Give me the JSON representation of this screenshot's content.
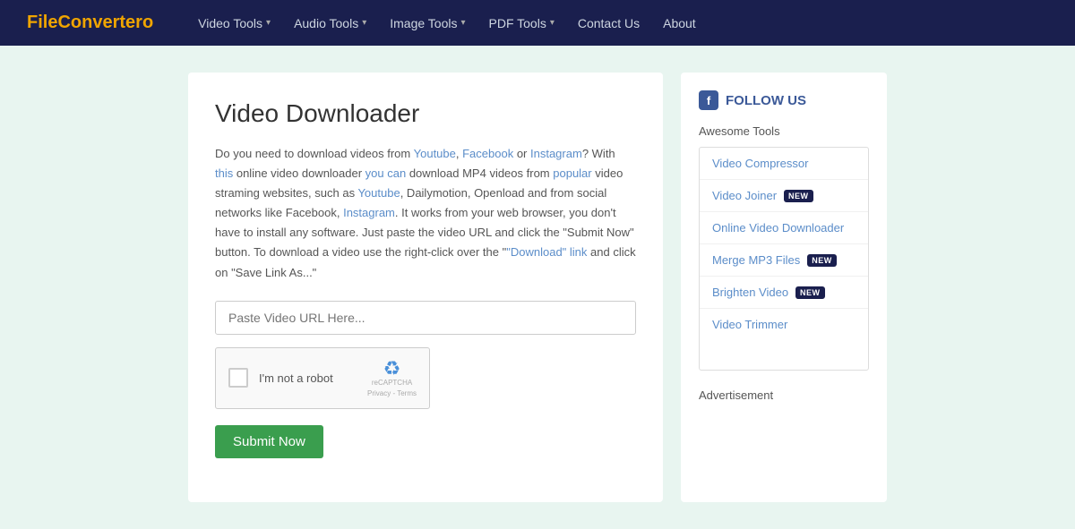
{
  "brand": {
    "name_start": "FileConverter",
    "name_highlight": "o"
  },
  "nav": {
    "links": [
      {
        "label": "Video Tools",
        "has_dropdown": true
      },
      {
        "label": "Audio Tools",
        "has_dropdown": true
      },
      {
        "label": "Image Tools",
        "has_dropdown": true
      },
      {
        "label": "PDF Tools",
        "has_dropdown": true
      },
      {
        "label": "Contact Us",
        "has_dropdown": false
      },
      {
        "label": "About",
        "has_dropdown": false
      }
    ]
  },
  "main": {
    "title": "Video Downloader",
    "description": "Do you need to download videos from Youtube, Facebook or Instagram? With this online video downloader you can download MP4 videos from popular video straming websites, such as Youtube, Dailymotion, Openload and from social networks like Facebook, Instagram. It works from your web browser, you don't have to install any software. Just paste the video URL and click the \"Submit Now\" button. To download a video use the right-click over the \"Download\" link and click on \"Save Link As...\"",
    "url_input_placeholder": "Paste Video URL Here...",
    "submit_label": "Submit Now",
    "recaptcha_label": "I'm not a robot",
    "recaptcha_brand": "reCAPTCHA",
    "recaptcha_privacy": "Privacy - Terms"
  },
  "sidebar": {
    "follow_label": "FOLLOW US",
    "awesome_tools_label": "Awesome Tools",
    "tools": [
      {
        "label": "Video Compressor",
        "is_new": false
      },
      {
        "label": "Video Joiner",
        "is_new": true
      },
      {
        "label": "Online Video Downloader",
        "is_new": false
      },
      {
        "label": "Merge MP3 Files",
        "is_new": true
      },
      {
        "label": "Brighten Video",
        "is_new": true
      },
      {
        "label": "Video Trimmer",
        "is_new": false
      }
    ],
    "advertisement_label": "Advertisement"
  }
}
